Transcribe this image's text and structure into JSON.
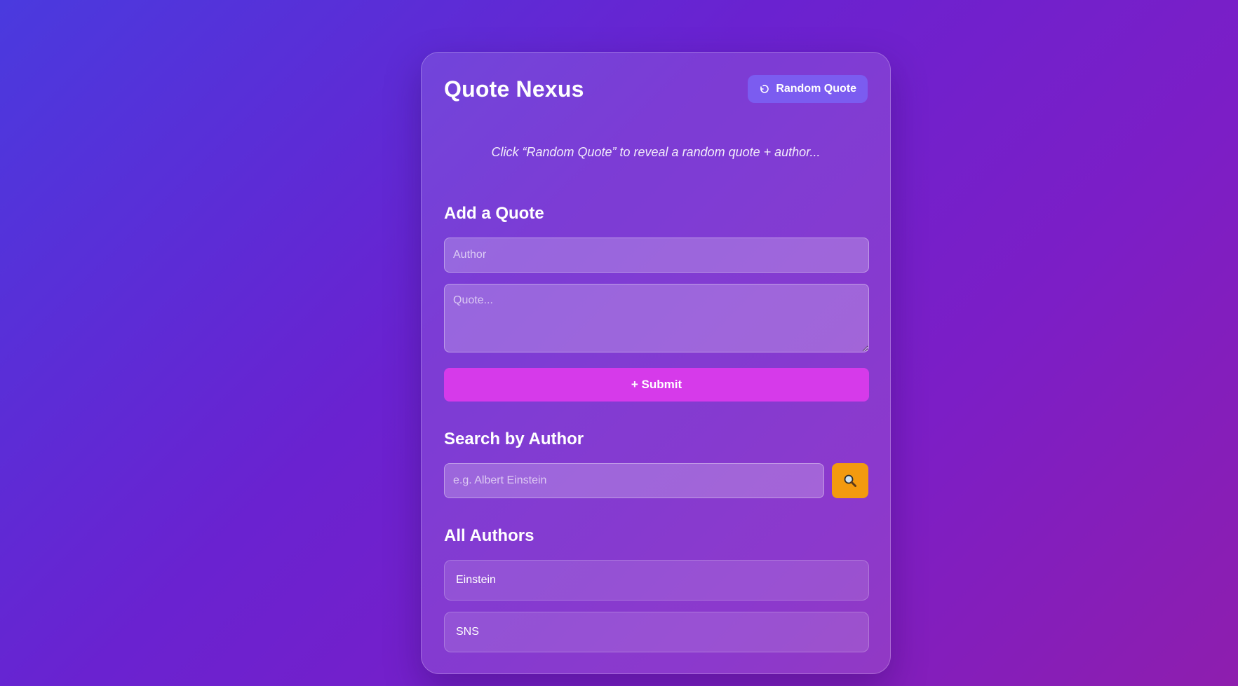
{
  "app": {
    "title": "Quote Nexus",
    "random_button_label": "Random Quote"
  },
  "quote_display": {
    "hint": "Click “Random Quote” to reveal a random quote + author..."
  },
  "add_quote": {
    "heading": "Add a Quote",
    "author_value": "",
    "author_placeholder": "Author",
    "quote_value": "",
    "quote_placeholder": "Quote...",
    "submit_label": "+ Submit"
  },
  "search": {
    "heading": "Search by Author",
    "value": "",
    "placeholder": "e.g. Albert Einstein",
    "button_icon": "search-icon"
  },
  "authors": {
    "heading": "All Authors",
    "items": [
      {
        "label": "Einstein"
      },
      {
        "label": "SNS"
      }
    ]
  },
  "colors": {
    "random_button": "#7b5cf0",
    "submit_button": "#d63aea",
    "search_button": "#f39a0f"
  }
}
